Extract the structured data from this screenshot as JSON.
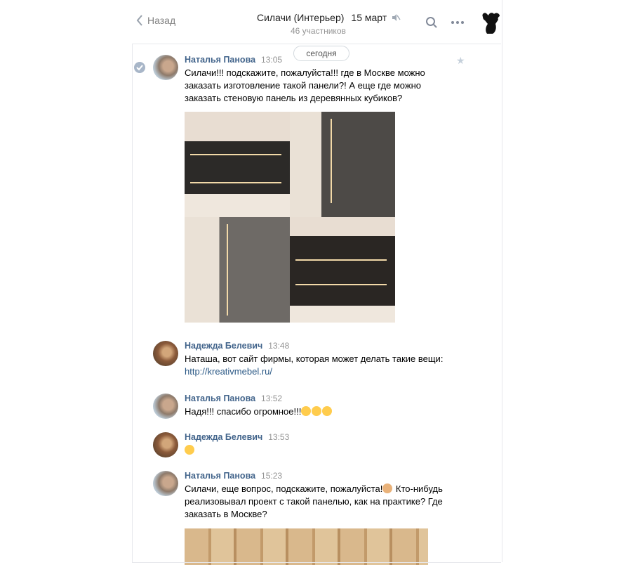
{
  "header": {
    "back_label": "Назад",
    "title": "Силачи (Интерьер)",
    "date": "15 март",
    "subtitle": "46 участников"
  },
  "divider": {
    "label": "сегодня"
  },
  "messages": [
    {
      "author": "Наталья Панова",
      "time": "13:05",
      "text": "Силачи!!! подскажите, пожалуйста!!! где в Москве можно заказать изготовление такой панели?! А еще где можно заказать стеновую панель из деревянных кубиков?"
    },
    {
      "author": "Надежда Белевич",
      "time": "13:48",
      "text": "Наташа, вот сайт фирмы, которая может делать такие вещи:",
      "link": "http://kreativmebel.ru/"
    },
    {
      "author": "Наталья Панова",
      "time": "13:52",
      "text": "Надя!!! спасибо огромное!!!"
    },
    {
      "author": "Надежда Белевич",
      "time": "13:53",
      "text": ""
    },
    {
      "author": "Наталья Панова",
      "time": "15:23",
      "text_a": "Силачи, еще вопрос, подскажите, пожалуйста!",
      "text_b": " Кто-нибудь реализовывал проект с такой панелью, как на практике? Где заказать в Москве?"
    }
  ],
  "icons": {
    "back": "chevron-left-icon",
    "mute": "muted-speaker-icon",
    "search": "search-icon",
    "more": "more-dots-icon",
    "star": "star-icon",
    "check": "read-check-icon"
  },
  "colors": {
    "author": "#42648b",
    "link": "#2a5885",
    "muted": "#939393"
  }
}
